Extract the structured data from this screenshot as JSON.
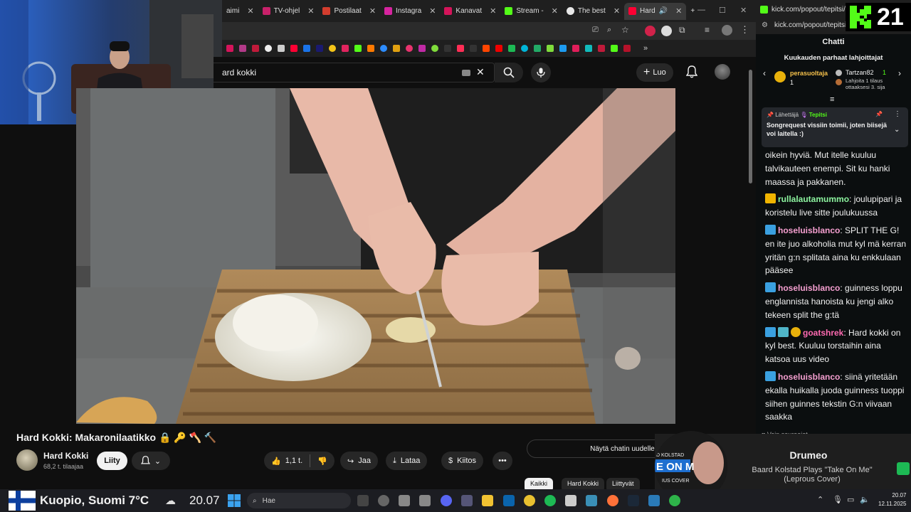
{
  "browser": {
    "tabs": [
      {
        "label": "aimi",
        "color": "#b6006b"
      },
      {
        "label": "TV-ohjel",
        "color": "#c8216a"
      },
      {
        "label": "Postilaat",
        "color": "#d33d2e"
      },
      {
        "label": "Instagra",
        "color": "#d6249f"
      },
      {
        "label": "Kanavat",
        "color": "#d4145a"
      },
      {
        "label": "Stream -",
        "color": "#53fc18"
      },
      {
        "label": "The best",
        "color": "#e8e8e8"
      },
      {
        "label": "Hard",
        "color": "#ff0033"
      }
    ],
    "new_tab": "+"
  },
  "youtube": {
    "search_value": "ard kokki",
    "create_label": "Luo",
    "video_title": "Hard Kokki: Makaronilaatikko 🔒 🔑 🪓 🔨",
    "channel_name": "Hard Kokki",
    "channel_subs": "68,2 t. tilaajaa",
    "join_label": "Liity",
    "like_count": "1,1 t.",
    "share_label": "Jaa",
    "download_label": "Lataa",
    "thanks_label": "Kiitos",
    "more_label": "•••",
    "show_chat_label": "Näytä chatin uudelleen",
    "chips": [
      "Kaikki",
      "Hard Kokki",
      "Liittyvät"
    ]
  },
  "kick": {
    "url": "kick.com/popout/tepitsi/ch...",
    "popout_url": "kick.com/popout/tepitsi/ch...",
    "badge_number": "21",
    "chat_title": "Chatti",
    "gifters_title": "Kuukauden parhaat lahjoittajat",
    "gifter1_name": "perasuoltaja",
    "gifter1_count": "1",
    "gifter2_name": "Tartzan82",
    "gifter2_count": "1",
    "gifter3_text": "Lahjoita 1 tilaus ottaaksesi 3. sija",
    "pinned_by_label": "Lähettäjä",
    "pinned_by_user": "Tepitsi",
    "pinned_text": "Songrequest vissiin toimii, joten biisejä voi laitella :)",
    "messages": [
      {
        "user": "",
        "text": "oikein hyviä. Mut itelle kuuluu talvikauteen enempi. Sit ku hanki maassa ja pakkanen."
      },
      {
        "user": "rullalautamummo",
        "color": "#8df5a0",
        "text": "joulupipari ja koristelu live sitte joulukuussa"
      },
      {
        "user": "hoseluisblanco",
        "color": "#f59fd0",
        "text": "SPLIT THE G! en ite juo alkoholia mut kyl mä kerran yritän g:n splitata aina ku enkkulaan pääsee"
      },
      {
        "user": "hoseluisblanco",
        "color": "#f59fd0",
        "text": "guinness loppu englannista hanoista ku jengi alko tekeen split the g:tä"
      },
      {
        "user": "goatshrek",
        "color": "#ff6ab1",
        "text": "Hard kokki on kyl best. Kuuluu torstaihin aina katsoa uus video"
      },
      {
        "user": "hoseluisblanco",
        "color": "#f59fd0",
        "text": "siinä yritetään ekalla huikalla juoda guinness tuoppi siihen guinnes tekstin G:n viivaan saakka"
      }
    ],
    "followers_only": "Vain seuraajat"
  },
  "now_playing": {
    "artist": "Drumeo",
    "track": "Baard Kolstad Plays \"Take On Me\" (Leprous Cover)",
    "art_text_1": "D KOLSTAD",
    "art_text_2": "E ON M",
    "art_text_3": "IUS COVER"
  },
  "taskbar": {
    "weather": "Kuopio, Suomi 7°C",
    "weather_time": "20.07",
    "search_placeholder": "Hae",
    "clock_time": "20.07",
    "clock_date": "12.11.2025"
  },
  "colors": {
    "kick_green": "#53fc18",
    "youtube_red": "#ff0033",
    "taskbar_bg": "#1c1d22"
  }
}
